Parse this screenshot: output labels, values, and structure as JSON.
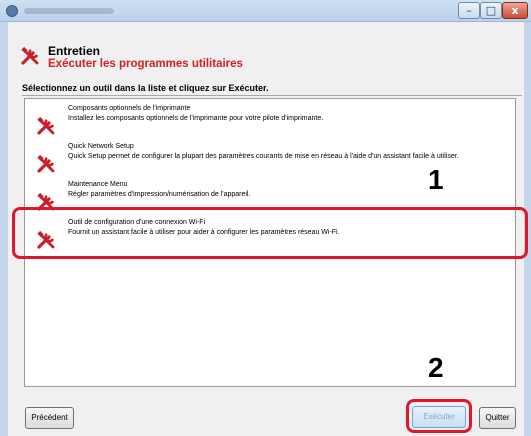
{
  "window": {
    "close_label": "x"
  },
  "header": {
    "title": "Entretien",
    "subtitle": "Exécuter les programmes utilitaires",
    "instruction": "Sélectionnez un outil dans la liste et cliquez sur Exécuter.",
    "icon": "tools-icon"
  },
  "list": {
    "items": [
      {
        "title": "Composants optionnels de l'imprimante",
        "description": "Installez les composants optionnels de l'imprimante pour votre pilote d'imprimante.",
        "icon": "tools-icon"
      },
      {
        "title": "Quick Network Setup",
        "description": "Quick Setup permet de configurer la plupart des paramètres courants de mise en réseau à l'aide d'un assistant facile à utiliser.",
        "icon": "tools-icon"
      },
      {
        "title": "Maintenance Menu",
        "description": "Régler paramètres d'impression/numérisation de l'appareil.",
        "icon": "tools-icon"
      },
      {
        "title": "Outil de configuration d'une connexion Wi-Fi",
        "description": "Fournit un assistant facile à utiliser pour aider à configurer les paramètres réseau Wi-Fi.",
        "icon": "tools-icon"
      }
    ]
  },
  "callouts": {
    "step1": "1",
    "step2": "2",
    "highlight_color": "#e2162a"
  },
  "buttons": {
    "previous": "Précédent",
    "execute": "Exécuter",
    "quit": "Quitter"
  },
  "colors": {
    "accent_red": "#d1202a",
    "titlebar": "#b9d1ea"
  }
}
